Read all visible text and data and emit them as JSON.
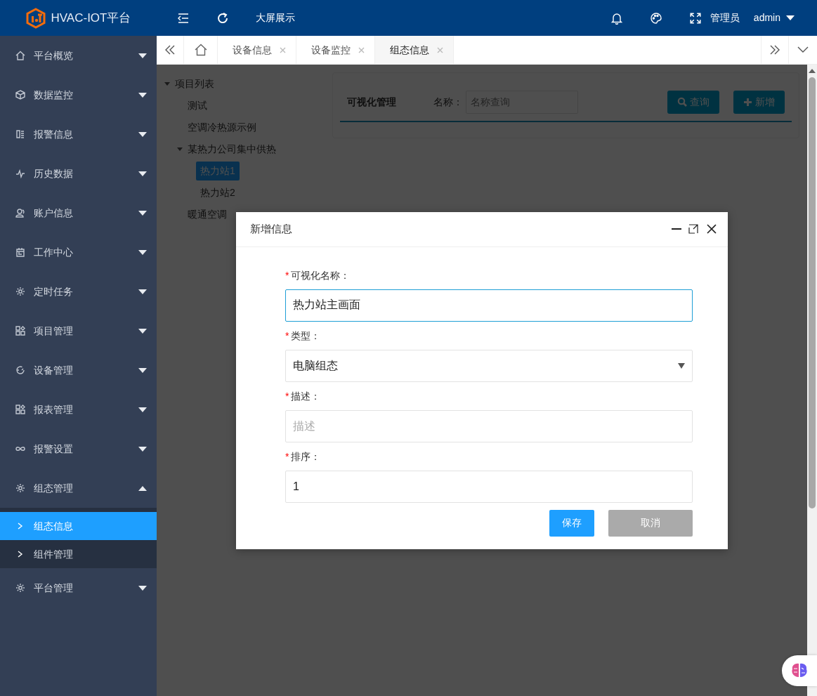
{
  "header": {
    "logo_text": "HVAC-IOT平台",
    "link": "大屏展示",
    "user_role": "管理员",
    "username": "admin"
  },
  "sidebar": {
    "items": [
      {
        "label": "平台概览",
        "expanded": false
      },
      {
        "label": "数据监控",
        "expanded": false
      },
      {
        "label": "报警信息",
        "expanded": false
      },
      {
        "label": "历史数据",
        "expanded": false
      },
      {
        "label": "账户信息",
        "expanded": false
      },
      {
        "label": "工作中心",
        "expanded": false
      },
      {
        "label": "定时任务",
        "expanded": false
      },
      {
        "label": "项目管理",
        "expanded": false
      },
      {
        "label": "设备管理",
        "expanded": false
      },
      {
        "label": "报表管理",
        "expanded": false
      },
      {
        "label": "报警设置",
        "expanded": false
      },
      {
        "label": "组态管理",
        "expanded": true,
        "children": [
          {
            "label": "组态信息",
            "selected": true
          },
          {
            "label": "组件管理",
            "selected": false
          }
        ]
      },
      {
        "label": "平台管理",
        "expanded": false
      }
    ]
  },
  "tabs": [
    {
      "label": "设备信息",
      "selected": false
    },
    {
      "label": "设备监控",
      "selected": false
    },
    {
      "label": "组态信息",
      "selected": true
    }
  ],
  "tree": [
    {
      "label": "项目列表",
      "expanded": true,
      "selected": false,
      "children": [
        {
          "label": "测试",
          "selected": false
        },
        {
          "label": "空调冷热源示例",
          "selected": false
        },
        {
          "label": "某热力公司集中供热",
          "expanded": true,
          "selected": false,
          "children": [
            {
              "label": "热力站1",
              "selected": true
            },
            {
              "label": "热力站2",
              "selected": false
            }
          ]
        },
        {
          "label": "暖通空调",
          "selected": false
        }
      ]
    }
  ],
  "panel": {
    "title": "可视化管理",
    "search_label": "名称：",
    "search_placeholder": "名称查询",
    "buttons": [
      {
        "label": "查询",
        "kind": "search"
      },
      {
        "label": "新增",
        "kind": "add"
      }
    ]
  },
  "dialog": {
    "title": "新增信息",
    "fields": [
      {
        "kind": "text",
        "required_mark": "*",
        "label": "可视化名称：",
        "value": "热力站主画面",
        "focused": true
      },
      {
        "kind": "select",
        "required_mark": "*",
        "label": "类型：",
        "value": "电脑组态",
        "focused": false
      },
      {
        "kind": "text",
        "required_mark": "*",
        "label": "描述：",
        "placeholder": "描述",
        "focused": false
      },
      {
        "kind": "text",
        "required_mark": "*",
        "label": "排序：",
        "value": "1",
        "focused": false
      }
    ],
    "buttons": [
      {
        "label": "保存",
        "kind": "primary"
      },
      {
        "label": "取消",
        "kind": "secondary"
      }
    ]
  }
}
